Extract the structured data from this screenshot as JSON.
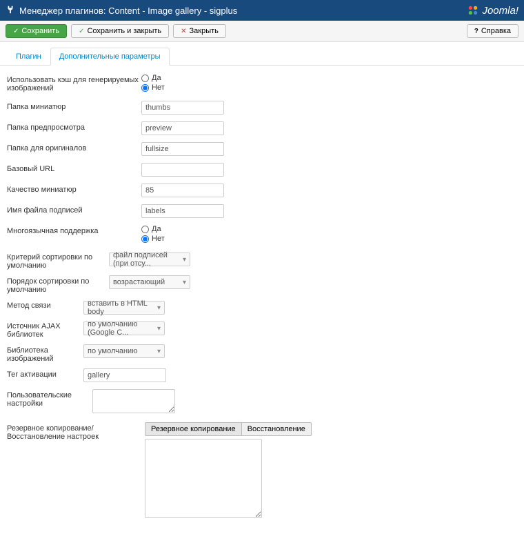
{
  "header": {
    "title": "Менеджер плагинов: Content - Image gallery - sigplus",
    "brand": "Joomla!"
  },
  "toolbar": {
    "save": "Сохранить",
    "saveClose": "Сохранить и закрыть",
    "close": "Закрыть",
    "help": "Справка"
  },
  "tabs": {
    "plugin": "Плагин",
    "advanced": "Дополнительные параметры"
  },
  "fields": {
    "useCache": {
      "label": "Использовать кэш для генерируемых изображений",
      "yes": "Да",
      "no": "Нет"
    },
    "thumbFolder": {
      "label": "Папка миниатюр",
      "value": "thumbs"
    },
    "previewFolder": {
      "label": "Папка предпросмотра",
      "value": "preview"
    },
    "fullsizeFolder": {
      "label": "Папка для оригиналов",
      "value": "fullsize"
    },
    "baseUrl": {
      "label": "Базовый URL",
      "value": ""
    },
    "thumbQuality": {
      "label": "Качество миниатюр",
      "value": "85"
    },
    "labelsFile": {
      "label": "Имя файла подписей",
      "value": "labels"
    },
    "multilang": {
      "label": "Многоязычная поддержка",
      "yes": "Да",
      "no": "Нет"
    },
    "sortCriterion": {
      "label": "Критерий сортировки по умолчанию",
      "value": "файл подписей (при отсу..."
    },
    "sortOrder": {
      "label": "Порядок сортировки по умолчанию",
      "value": "возрастающий"
    },
    "linkage": {
      "label": "Метод связи",
      "value": "вставить в HTML body"
    },
    "ajaxSource": {
      "label": "Источник AJAX библиотек",
      "value": "по умолчанию (Google C..."
    },
    "imgLibrary": {
      "label": "Библиотека изображений",
      "value": "по умолчанию"
    },
    "activationTag": {
      "label": "Тег активации",
      "value": "gallery"
    },
    "userSettings": {
      "label": "Пользовательские настройки"
    },
    "backup": {
      "label": "Резервное копирование/Восстановление настроек",
      "btnBackup": "Резервное копирование",
      "btnRestore": "Восстановление"
    }
  }
}
